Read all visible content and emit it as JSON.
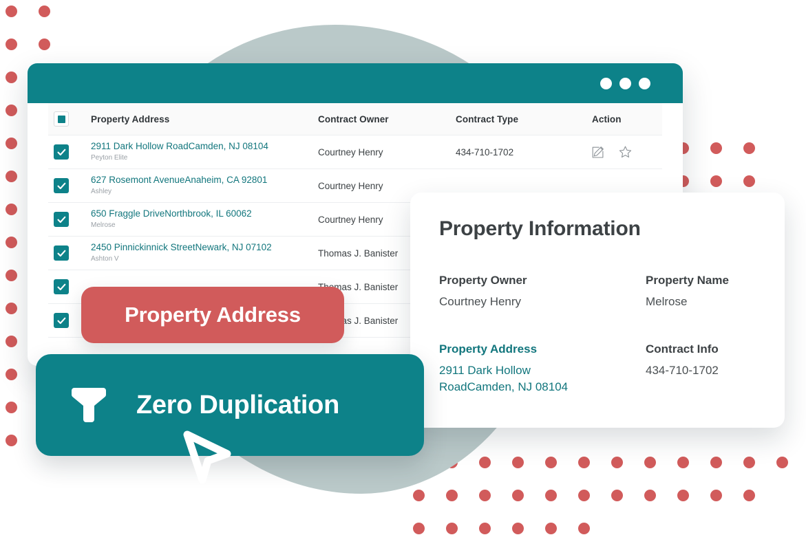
{
  "theme": {
    "teal": "#0d8289",
    "teal_text": "#12767d",
    "coral": "#d15b5b",
    "blob": "#bac9c9",
    "card_bg": "#ffffff",
    "header_bg": "#fafafa"
  },
  "window": {
    "titlebar_dots": [
      "dot-1",
      "dot-2",
      "dot-3"
    ]
  },
  "table": {
    "columns": [
      {
        "key": "select",
        "label": ""
      },
      {
        "key": "address",
        "label": "Property Address"
      },
      {
        "key": "owner",
        "label": "Contract Owner"
      },
      {
        "key": "type",
        "label": "Contract Type"
      },
      {
        "key": "action",
        "label": "Action"
      }
    ],
    "header_checkbox_state": "indeterminate",
    "rows": [
      {
        "checked": true,
        "address": "2911 Dark Hollow RoadCamden, NJ 08104",
        "name": "Peyton Elite",
        "owner": "Courtney Henry",
        "type": "434-710-1702",
        "actions": [
          "edit-icon",
          "star-icon"
        ]
      },
      {
        "checked": true,
        "address": "627 Rosemont AvenueAnaheim, CA 92801",
        "name": "Ashley",
        "owner": "Courtney Henry",
        "type": "",
        "actions": []
      },
      {
        "checked": true,
        "address": "650 Fraggle DriveNorthbrook, IL 60062",
        "name": "Melrose",
        "owner": "Courtney Henry",
        "type": "",
        "actions": []
      },
      {
        "checked": true,
        "address": "2450 Pinnickinnick StreetNewark, NJ 07102",
        "name": "Ashton V",
        "owner": "Thomas J. Banister",
        "type": "",
        "actions": []
      },
      {
        "checked": true,
        "address": "",
        "name": "",
        "owner": "Thomas J. Banister",
        "type": "",
        "actions": []
      },
      {
        "checked": true,
        "address": "",
        "name": "",
        "owner": "Thomas J. Banister",
        "type": "",
        "actions": []
      }
    ]
  },
  "info_card": {
    "title": "Property Information",
    "fields": [
      {
        "label": "Property  Owner",
        "value": "Courtney Henry",
        "accent": false
      },
      {
        "label": "Property Name",
        "value": "Melrose",
        "accent": false
      },
      {
        "label": "Property Address",
        "value": "2911 Dark Hollow RoadCamden, NJ 08104",
        "accent": true
      },
      {
        "label": "Contract Info",
        "value": "434-710-1702",
        "accent": false
      }
    ]
  },
  "badges": {
    "red_label": "Property Address",
    "teal_label": "Zero Duplication",
    "teal_icon": "funnel-icon",
    "cursor_icon": "cursor-pointer-icon"
  }
}
